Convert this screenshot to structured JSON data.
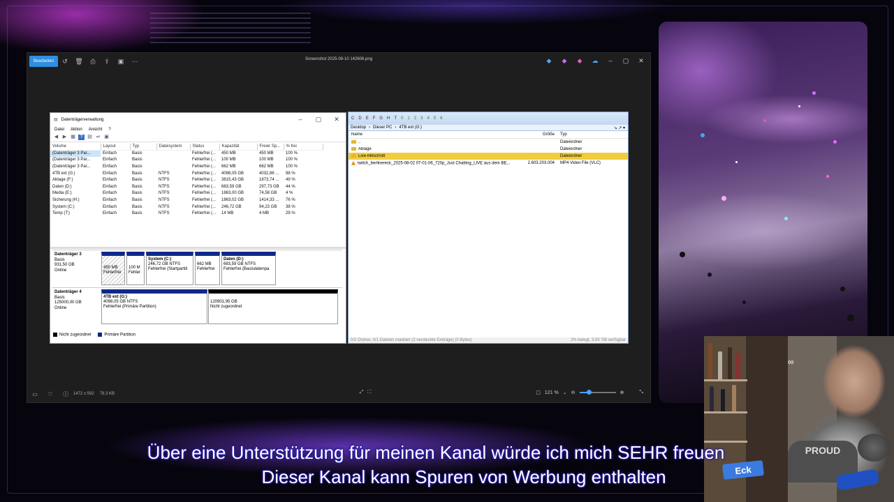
{
  "viewer": {
    "edit_button": "Bearbeiten",
    "title": "Screenshot 2025-08-10 142606.png",
    "status_dims": "1472 x 592",
    "status_size": "79,3 KB",
    "zoom": "121 %"
  },
  "disk_management": {
    "title": "Datenträgerverwaltung",
    "menu": [
      "Datei",
      "Aktion",
      "Ansicht",
      "?"
    ],
    "columns": [
      "Volume",
      "Layout",
      "Typ",
      "Dateisystem",
      "Status",
      "Kapazität",
      "Freier Sp...",
      "% frei"
    ],
    "rows": [
      [
        "(Datenträger 3 Par...",
        "Einfach",
        "Basis",
        "",
        "Fehlerfrei (...",
        "450 MB",
        "450 MB",
        "100 %"
      ],
      [
        "(Datenträger 3 Par...",
        "Einfach",
        "Basis",
        "",
        "Fehlerfrei (...",
        "100 MB",
        "100 MB",
        "100 %"
      ],
      [
        "(Datenträger 3 Par...",
        "Einfach",
        "Basis",
        "",
        "Fehlerfrei (...",
        "662 MB",
        "662 MB",
        "100 %"
      ],
      [
        "4TB ext (G:)",
        "Einfach",
        "Basis",
        "NTFS",
        "Fehlerfrei (...",
        "4098,05 GB",
        "4032,86 ...",
        "98 %"
      ],
      [
        "Ablage (F:)",
        "Einfach",
        "Basis",
        "NTFS",
        "Fehlerfrei (...",
        "3815,43 GB",
        "1873,74 ...",
        "49 %"
      ],
      [
        "Daten (D:)",
        "Einfach",
        "Basis",
        "NTFS",
        "Fehlerfrei (...",
        "683,59 GB",
        "297,73 GB",
        "44 %"
      ],
      [
        "Media (E:)",
        "Einfach",
        "Basis",
        "NTFS",
        "Fehlerfrei (...",
        "1863,00 GB",
        "74,58 GB",
        "4 %"
      ],
      [
        "Sicherung (H:)",
        "Einfach",
        "Basis",
        "NTFS",
        "Fehlerfrei (...",
        "1863,02 GB",
        "1414,33 ...",
        "76 %"
      ],
      [
        "System (C:)",
        "Einfach",
        "Basis",
        "NTFS",
        "Fehlerfrei (...",
        "246,72 GB",
        "94,23 GB",
        "38 %"
      ],
      [
        "Temp (T:)",
        "Einfach",
        "Basis",
        "NTFS",
        "Fehlerfrei (...",
        "14 MB",
        "4 MB",
        "29 %"
      ]
    ],
    "disk3": {
      "name": "Datenträger 3",
      "type": "Basis",
      "size": "931,50 GB",
      "state": "Online",
      "partitions": [
        {
          "name": "",
          "size": "450 MB",
          "status": "Fehlerfrei"
        },
        {
          "name": "",
          "size": "100 M",
          "status": "Fehler"
        },
        {
          "name": "System (C:)",
          "size": "246,72 GB NTFS",
          "status": "Fehlerfrei (Startpartiti"
        },
        {
          "name": "",
          "size": "662 MB",
          "status": "Fehlerfrei"
        },
        {
          "name": "Daten (D:)",
          "size": "683,59 GB NTFS",
          "status": "Fehlerfrei (Basisdatenpa"
        }
      ]
    },
    "disk4": {
      "name": "Datenträger 4",
      "type": "Basis",
      "size": "125000,00 GB",
      "state": "Online",
      "partitions": [
        {
          "name": "4TB ext (G:)",
          "size": "4098,05 GB NTFS",
          "status": "Fehlerfrei (Primäre Partition)"
        },
        {
          "name": "",
          "size": "120901,95 GB",
          "status": "Nicht zugeordnet"
        }
      ]
    },
    "legend": [
      "Nicht zugeordnet",
      "Primäre Partition"
    ]
  },
  "explorer": {
    "drives": [
      "C",
      "D",
      "E",
      "F",
      "G",
      "H",
      "T"
    ],
    "tabs": [
      "0",
      "1",
      "2",
      "3",
      "4",
      "5",
      "6"
    ],
    "path": [
      "Desktop",
      "Dieser PC",
      "4TB ext (G:)"
    ],
    "columns": {
      "name": "Name",
      "size": "Größe",
      "type": "Typ"
    },
    "rows": [
      {
        "name": "..",
        "size": "",
        "type": "Dateiordner",
        "kind": "up"
      },
      {
        "name": "Ablage",
        "size": "",
        "type": "Dateiordner",
        "kind": "folder"
      },
      {
        "name": "Live-Mitschnitt",
        "size": "",
        "type": "Dateiordner",
        "kind": "folder"
      },
      {
        "name": "twitch_berlinereck_2025-08-02 07-01-06_720p_Just Chatting_LIVE aus dem BE...",
        "size": "2.603.203.004",
        "type": "MP4 Video File (VLC)",
        "kind": "video"
      }
    ],
    "status_left": "0/2 Ordner, 0/1 Dateien markiert (2 versteckte Einträge) (0 Bytes)",
    "status_right": "2% belegt, 3,93 TiB verfügbar"
  },
  "stream": {
    "caption_line1": "Über eine Unterstützung für meinen Kanal würde ich mich SEHR freuen",
    "caption_line2": "Dieser Kanal kann Spuren von Werbung enthalten",
    "badge": "Eck"
  }
}
